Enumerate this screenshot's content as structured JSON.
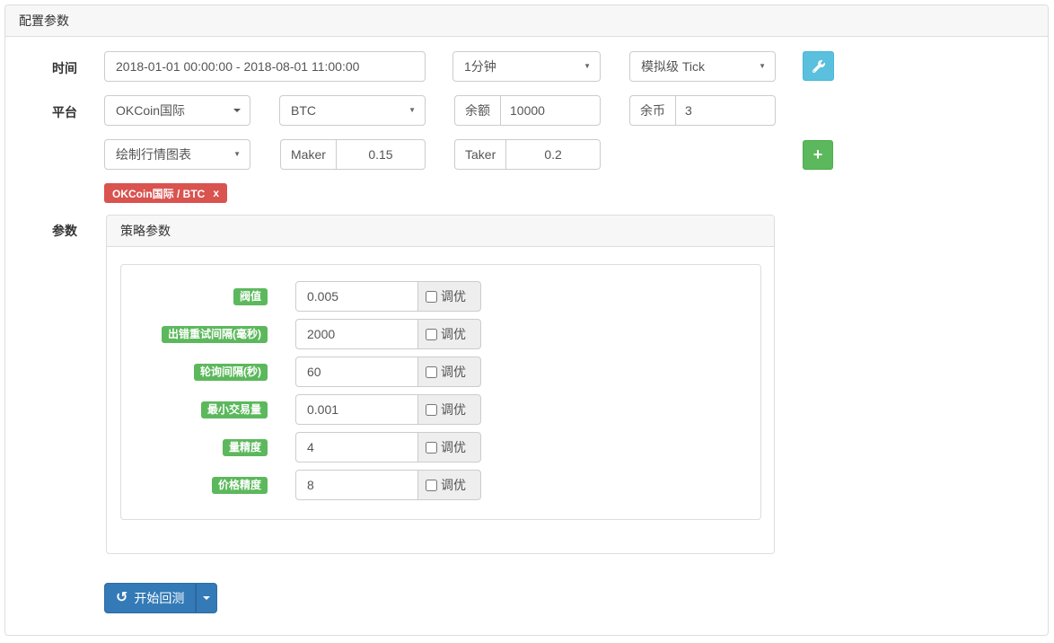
{
  "header": {
    "title": "配置参数"
  },
  "rows": {
    "time": {
      "label": "时间",
      "range": "2018-01-01 00:00:00 - 2018-08-01 11:00:00",
      "period": "1分钟",
      "tick_mode": "模拟级 Tick"
    },
    "platform": {
      "label": "平台",
      "exchange": "OKCoin国际",
      "coin": "BTC",
      "balance_label": "余额",
      "balance": "10000",
      "stocks_label": "余币",
      "stocks": "3"
    },
    "options": {
      "chart_mode": "绘制行情图表",
      "maker_label": "Maker",
      "maker": "0.15",
      "taker_label": "Taker",
      "taker": "0.2"
    },
    "pair_tag": {
      "text": "OKCoin国际 / BTC",
      "close": "x"
    }
  },
  "params": {
    "label": "参数",
    "panel_title": "策略参数",
    "tune": "调优",
    "items": [
      {
        "name": "阀值",
        "value": "0.005"
      },
      {
        "name": "出错重试间隔(毫秒)",
        "value": "2000"
      },
      {
        "name": "轮询间隔(秒)",
        "value": "60"
      },
      {
        "name": "最小交易量",
        "value": "0.001"
      },
      {
        "name": "量精度",
        "value": "4"
      },
      {
        "name": "价格精度",
        "value": "8"
      }
    ]
  },
  "footer": {
    "start": "开始回测"
  },
  "icons": {
    "plus": "+",
    "repeat": "↺",
    "caret": "▼"
  },
  "colors": {
    "primary": "#337ab7",
    "info": "#5bc0de",
    "success": "#5cb85c",
    "danger": "#d9534f"
  }
}
